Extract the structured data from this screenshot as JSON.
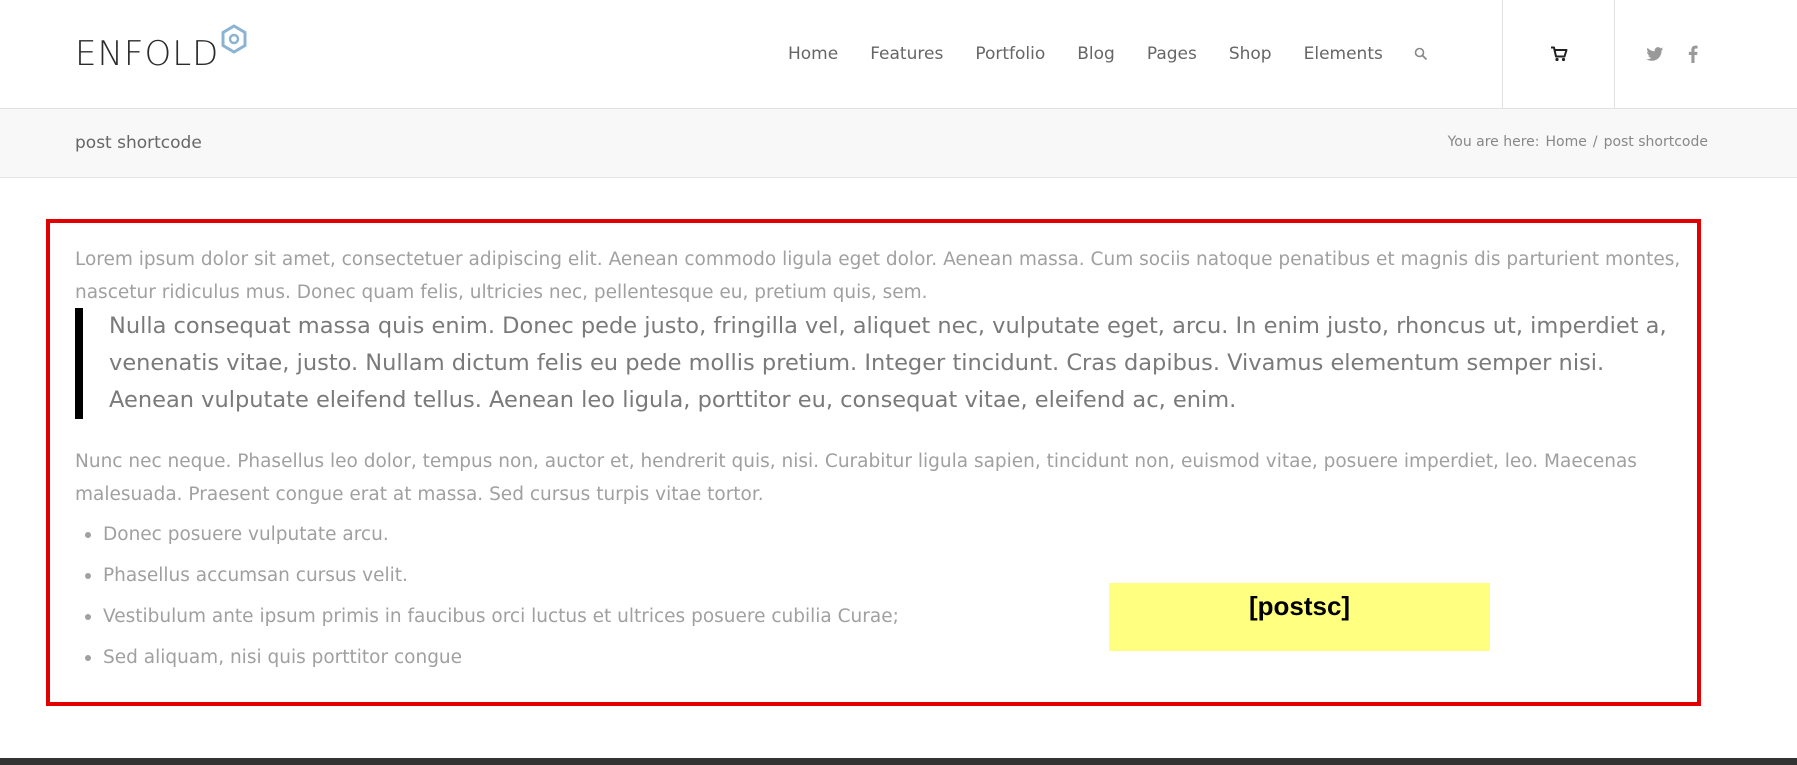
{
  "header": {
    "logo_text": "ENFOLD",
    "logo_icon": "hexagon-icon",
    "nav_items": [
      "Home",
      "Features",
      "Portfolio",
      "Blog",
      "Pages",
      "Shop",
      "Elements"
    ],
    "search_icon": "search-icon",
    "cart_icon": "cart-icon",
    "social": [
      "twitter-icon",
      "facebook-icon"
    ]
  },
  "titlebar": {
    "page_title": "post shortcode",
    "breadcrumb_prefix": "You are here:",
    "breadcrumb_home": "Home",
    "breadcrumb_sep": "/",
    "breadcrumb_current": "post shortcode"
  },
  "content": {
    "paragraph1": "Lorem ipsum dolor sit amet, consectetuer adipiscing elit. Aenean commodo ligula eget dolor. Aenean massa. Cum sociis natoque penatibus et magnis dis parturient montes, nascetur ridiculus mus. Donec quam felis, ultricies nec, pellentesque eu, pretium quis, sem.",
    "blockquote": "Nulla consequat massa quis enim. Donec pede justo, fringilla vel, aliquet nec, vulputate eget, arcu. In enim justo, rhoncus ut, imperdiet a, venenatis vitae, justo. Nullam dictum felis eu pede mollis pretium. Integer tincidunt. Cras dapibus. Vivamus elementum semper nisi. Aenean vulputate eleifend tellus. Aenean leo ligula, porttitor eu, consequat vitae, eleifend ac, enim.",
    "paragraph2": "Nunc nec neque. Phasellus leo dolor, tempus non, auctor et, hendrerit quis, nisi. Curabitur ligula sapien, tincidunt non, euismod vitae, posuere imperdiet, leo. Maecenas malesuada. Praesent congue erat at massa. Sed cursus turpis vitae tortor.",
    "list": [
      "Donec posuere vulputate arcu.",
      "Phasellus accumsan cursus velit.",
      "Vestibulum ante ipsum primis in faucibus orci luctus et ultrices posuere cubilia Curae;",
      "Sed aliquam, nisi quis porttitor congue"
    ],
    "shortcode_label": "[postsc]"
  },
  "colors": {
    "highlight_border": "#e00000",
    "shortcode_bg": "#ffff80",
    "logo_accent": "#8cb4d2"
  }
}
